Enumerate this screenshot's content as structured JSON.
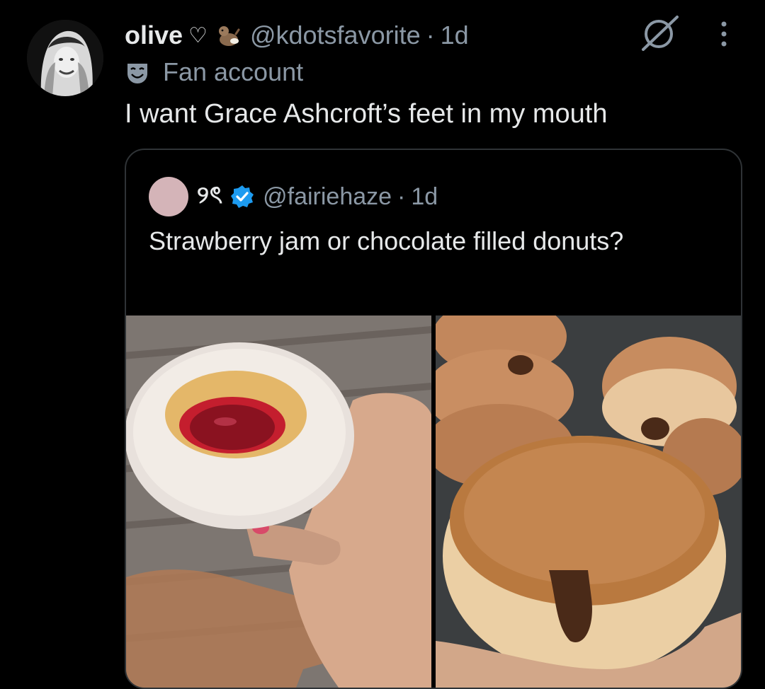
{
  "tweet": {
    "display_name": "olive",
    "name_emoji": "♡",
    "badge_icon": "otter-emoji-icon",
    "handle": "@kdotsfavorite",
    "separator": "·",
    "time": "1d",
    "label": "Fan account",
    "text": "I want Grace Ashcroft’s feet in my mouth"
  },
  "quoted": {
    "display_name": "୨ৎ",
    "verified": true,
    "handle": "@fairiehaze",
    "separator": "·",
    "time": "1d",
    "text": "Strawberry jam or chocolate filled donuts?",
    "media": [
      {
        "name": "strawberry-jam-donut-photo"
      },
      {
        "name": "chocolate-filled-donut-photo"
      }
    ]
  },
  "icons": {
    "grok": "grok-icon",
    "more": "more-options-icon",
    "label": "mask-icon",
    "verified": "verified-badge-icon"
  },
  "colors": {
    "background": "#000000",
    "text_primary": "#e7e9ea",
    "text_secondary": "#8b98a5",
    "verified": "#1d9bf0",
    "border": "#2f3336"
  }
}
